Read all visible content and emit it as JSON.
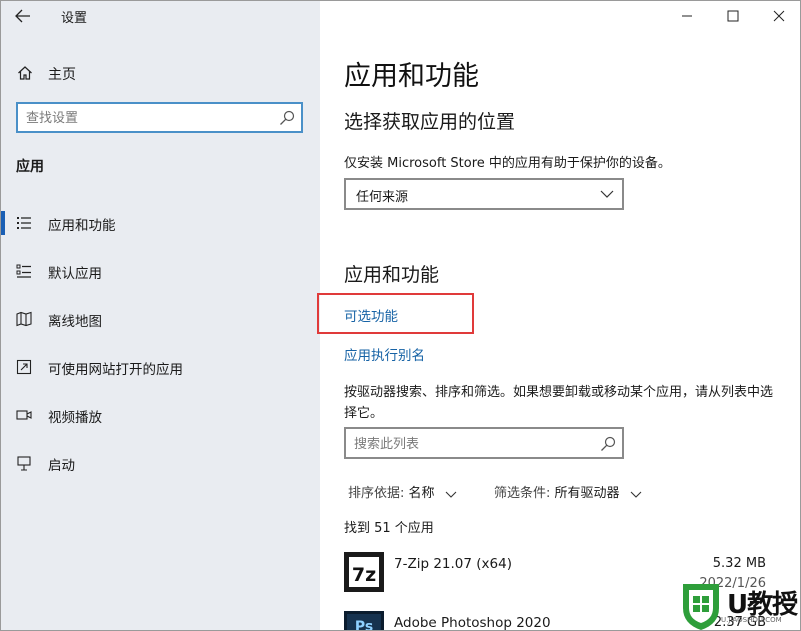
{
  "window": {
    "title": "设置"
  },
  "sidebar": {
    "home_label": "主页",
    "search_placeholder": "查找设置",
    "section_heading": "应用",
    "items": [
      {
        "label": "应用和功能",
        "icon": "apps-features-icon",
        "active": true
      },
      {
        "label": "默认应用",
        "icon": "default-apps-icon",
        "active": false
      },
      {
        "label": "离线地图",
        "icon": "offline-maps-icon",
        "active": false
      },
      {
        "label": "可使用网站打开的应用",
        "icon": "apps-for-websites-icon",
        "active": false
      },
      {
        "label": "视频播放",
        "icon": "video-playback-icon",
        "active": false
      },
      {
        "label": "启动",
        "icon": "startup-icon",
        "active": false
      }
    ]
  },
  "main": {
    "title": "应用和功能",
    "choose_location": {
      "heading": "选择获取应用的位置",
      "description": "仅安装 Microsoft Store 中的应用有助于保护你的设备。",
      "dropdown_value": "任何来源"
    },
    "apps_section": {
      "heading": "应用和功能",
      "optional_features_link": "可选功能",
      "app_alias_link": "应用执行别名",
      "description": "按驱动器搜索、排序和筛选。如果想要卸载或移动某个应用，请从列表中选择它。",
      "search_placeholder": "搜索此列表",
      "sort_label": "排序依据:",
      "sort_value": "名称",
      "filter_label": "筛选条件:",
      "filter_value": "所有驱动器",
      "count_text": "找到 51 个应用"
    },
    "apps": [
      {
        "name": "7-Zip 21.07 (x64)",
        "size": "5.32 MB",
        "date": "2022/1/26"
      },
      {
        "name": "Adobe Photoshop 2020",
        "size": "2.37 GB",
        "date": ""
      }
    ]
  },
  "watermark": {
    "text": "U教授",
    "sub": "U.JIAOSHOU.COM"
  },
  "colors": {
    "accent": "#1a5fb4",
    "link": "#1763a6",
    "highlight": "#e03a3a",
    "sidebar_bg": "#e9ecf1"
  }
}
